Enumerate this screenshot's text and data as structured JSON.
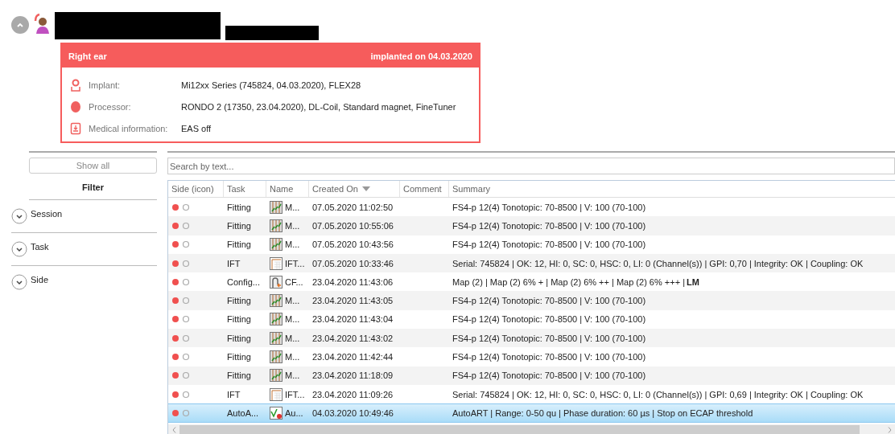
{
  "ear_card": {
    "title": "Right ear",
    "implanted": "implanted on 04.03.2020",
    "rows": [
      {
        "kind": "implant",
        "label": "Implant:",
        "value": "Mi12xx Series (745824, 04.03.2020), FLEX28"
      },
      {
        "kind": "processor",
        "label": "Processor:",
        "value": "RONDO 2 (17350, 23.04.2020), DL-Coil, Standard magnet, FineTuner"
      },
      {
        "kind": "medical",
        "label": "Medical information:",
        "value": "EAS off"
      }
    ]
  },
  "filter_panel": {
    "show_all": "Show all",
    "title": "Filter",
    "groups": [
      {
        "label": "Session",
        "expanded": false
      },
      {
        "label": "Task",
        "expanded": false
      },
      {
        "label": "Side",
        "expanded": false
      }
    ]
  },
  "search": {
    "placeholder": "Search by text..."
  },
  "table": {
    "columns": [
      {
        "label": "Side (icon)",
        "sorted": false
      },
      {
        "label": "Task",
        "sorted": false
      },
      {
        "label": "Name",
        "sorted": false
      },
      {
        "label": "Created On",
        "sorted": true
      },
      {
        "label": "Comment",
        "sorted": false
      },
      {
        "label": "Summary",
        "sorted": false
      }
    ],
    "rows": [
      {
        "kind": "fitting",
        "task": "Fitting",
        "name": "M...",
        "created": "07.05.2020 11:02:50",
        "summary": "FS4-p 12(4) Tonotopic: 70-8500 | V: 100 (70-100)",
        "selected": false
      },
      {
        "kind": "fitting",
        "task": "Fitting",
        "name": "M...",
        "created": "07.05.2020 10:55:06",
        "summary": "FS4-p 12(4) Tonotopic: 70-8500 | V: 100 (70-100)",
        "selected": false
      },
      {
        "kind": "fitting",
        "task": "Fitting",
        "name": "M...",
        "created": "07.05.2020 10:43:56",
        "summary": "FS4-p 12(4) Tonotopic: 70-8500 | V: 100 (70-100)",
        "selected": false
      },
      {
        "kind": "ift",
        "task": "IFT",
        "name": "IFT...",
        "created": "07.05.2020 10:33:46",
        "summary": "Serial: 745824 | OK: 12, HI: 0, SC: 0, HSC: 0, LI: 0 (Channel(s)) | GPI: 0,70 | Integrity: OK | Coupling: OK",
        "selected": false
      },
      {
        "kind": "config",
        "task": "Config...",
        "name": "CF...",
        "created": "23.04.2020 11:43:06",
        "summary": "Map (2) | Map (2) 6% + | Map (2) 6% ++ | Map (2) 6% +++ | **LM**",
        "selected": false
      },
      {
        "kind": "fitting",
        "task": "Fitting",
        "name": "M...",
        "created": "23.04.2020 11:43:05",
        "summary": "FS4-p 12(4) Tonotopic: 70-8500 | V: 100 (70-100)",
        "selected": false
      },
      {
        "kind": "fitting",
        "task": "Fitting",
        "name": "M...",
        "created": "23.04.2020 11:43:04",
        "summary": "FS4-p 12(4) Tonotopic: 70-8500 | V: 100 (70-100)",
        "selected": false
      },
      {
        "kind": "fitting",
        "task": "Fitting",
        "name": "M...",
        "created": "23.04.2020 11:43:02",
        "summary": "FS4-p 12(4) Tonotopic: 70-8500 | V: 100 (70-100)",
        "selected": false
      },
      {
        "kind": "fitting",
        "task": "Fitting",
        "name": "M...",
        "created": "23.04.2020 11:42:44",
        "summary": "FS4-p 12(4) Tonotopic: 70-8500 | V: 100 (70-100)",
        "selected": false
      },
      {
        "kind": "fitting",
        "task": "Fitting",
        "name": "M...",
        "created": "23.04.2020 11:18:09",
        "summary": "FS4-p 12(4) Tonotopic: 70-8500 | V: 100 (70-100)",
        "selected": false
      },
      {
        "kind": "ift",
        "task": "IFT",
        "name": "IFT...",
        "created": "23.04.2020 11:09:26",
        "summary": "Serial: 745824 | OK: 12, HI: 0, SC: 0, HSC: 0, LI: 0 (Channel(s)) | GPI: 0,69 | Integrity: OK | Coupling: OK",
        "selected": false
      },
      {
        "kind": "autoart",
        "task": "AutoA...",
        "name": "Au...",
        "created": "04.03.2020 10:49:46",
        "summary": "AutoART | Range: 0-50 qu | Phase duration: 60 µs | Stop on ECAP threshold",
        "selected": true
      }
    ]
  }
}
